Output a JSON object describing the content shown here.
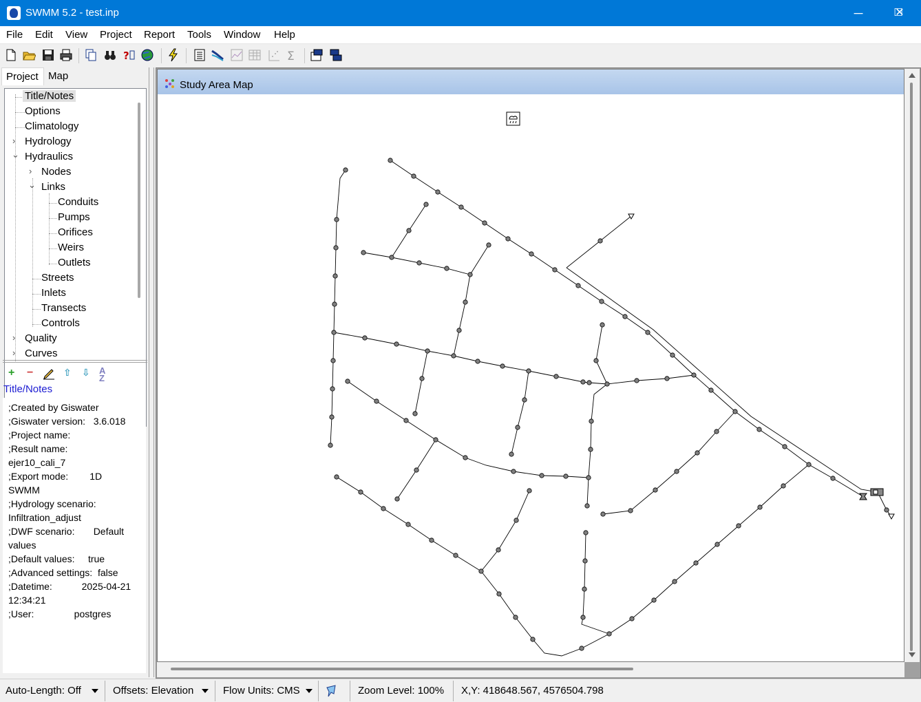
{
  "window": {
    "title": "SWMM 5.2 - test.inp",
    "minimize": "─",
    "maximize": "☐",
    "close": "✕"
  },
  "menu": [
    "File",
    "Edit",
    "View",
    "Project",
    "Report",
    "Tools",
    "Window",
    "Help"
  ],
  "left_panel": {
    "tabs": [
      "Project",
      "Map"
    ],
    "tree": [
      {
        "label": "Title/Notes",
        "selected": true
      },
      {
        "label": "Options"
      },
      {
        "label": "Climatology"
      },
      {
        "label": "Hydrology",
        "expander": "›"
      },
      {
        "label": "Hydraulics",
        "expander": "⌄"
      },
      {
        "label": "Nodes",
        "expander": "›"
      },
      {
        "label": "Links",
        "expander": "⌄"
      },
      {
        "label": "Conduits"
      },
      {
        "label": "Pumps"
      },
      {
        "label": "Orifices"
      },
      {
        "label": "Weirs"
      },
      {
        "label": "Outlets"
      },
      {
        "label": "Streets"
      },
      {
        "label": "Inlets"
      },
      {
        "label": "Transects"
      },
      {
        "label": "Controls"
      },
      {
        "label": "Quality",
        "expander": "›"
      },
      {
        "label": "Curves",
        "expander": "›"
      }
    ],
    "property_title": "Title/Notes",
    "notes": ";Created by Giswater\n;Giswater version:   3.6.018\n;Project name:\n;Result name:\nejer10_cali_7\n;Export mode:        1D\nSWMM\n;Hydrology scenario:\nInfiltration_adjust\n;DWF scenario:       Default\nvalues\n;Default values:     true\n;Advanced settings:  false\n;Datetime:           2025-04-21\n12:34:21\n;User:               postgres"
  },
  "map_window": {
    "title": "Study Area Map"
  },
  "status": {
    "auto_length": "Auto-Length: Off",
    "offsets": "Offsets: Elevation",
    "flow_units": "Flow Units: CMS",
    "zoom": "Zoom Level: 100%",
    "xy": "X,Y: 418648.567, 4576504.798"
  },
  "colors": {
    "titlebar": "#0078d7",
    "map_title": "#b4cceb",
    "link": "#000000",
    "node": "#808080"
  }
}
